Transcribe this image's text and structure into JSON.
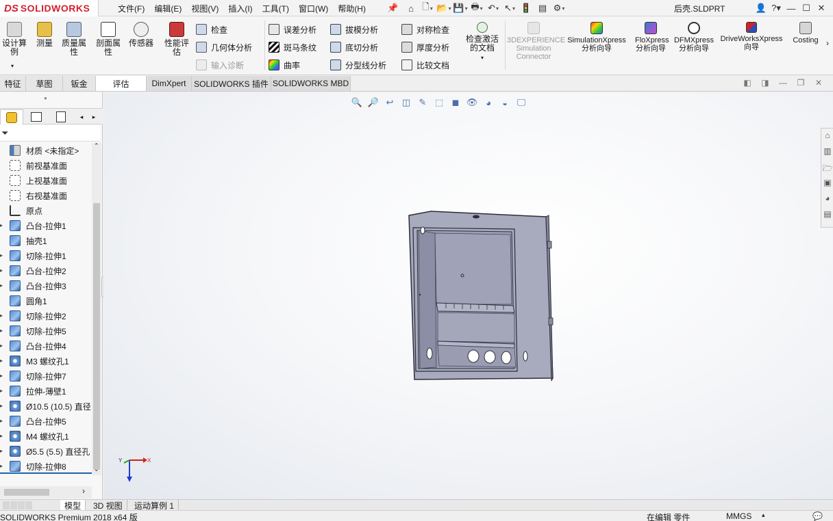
{
  "app": {
    "logo_ds": "DS",
    "logo_text": "SOLIDWORKS",
    "doc_title": "后壳.SLDPRT"
  },
  "menu": [
    "文件(F)",
    "编辑(E)",
    "视图(V)",
    "插入(I)",
    "工具(T)",
    "窗口(W)",
    "帮助(H)"
  ],
  "toolbar_big": [
    {
      "label": "设计算例",
      "icon": "design-study-icon"
    },
    {
      "label": "测量",
      "icon": "measure-icon"
    },
    {
      "label": "质量属性",
      "icon": "mass-properties-icon"
    },
    {
      "label": "剖面属性",
      "icon": "section-properties-icon"
    },
    {
      "label": "传感器",
      "icon": "sensor-icon"
    },
    {
      "label": "性能评估",
      "icon": "performance-evaluation-icon"
    }
  ],
  "toolbar_col1": [
    {
      "label": "检查",
      "disabled": false
    },
    {
      "label": "几何体分析",
      "disabled": false
    },
    {
      "label": "输入诊断",
      "disabled": true
    }
  ],
  "toolbar_col2": [
    {
      "label": "误差分析"
    },
    {
      "label": "斑马条纹"
    },
    {
      "label": "曲率"
    }
  ],
  "toolbar_col3": [
    {
      "label": "拔模分析"
    },
    {
      "label": "底切分析"
    },
    {
      "label": "分型线分析"
    }
  ],
  "toolbar_col4": [
    {
      "label": "对称检查"
    },
    {
      "label": "厚度分析"
    },
    {
      "label": "比较文档"
    }
  ],
  "toolbar_check_active": "检查激活的文档",
  "toolbar_addins": [
    {
      "label": "3DEXPERIENCE Simulation Connector",
      "disabled": true
    },
    {
      "label": "SimulationXpress 分析向导",
      "disabled": false
    },
    {
      "label": "FloXpress 分析向导",
      "disabled": false
    },
    {
      "label": "DFMXpress 分析向导",
      "disabled": false
    },
    {
      "label": "DriveWorksXpress 向导",
      "disabled": false
    },
    {
      "label": "Costing",
      "disabled": false
    }
  ],
  "tabs": [
    {
      "label": "特征",
      "active": false
    },
    {
      "label": "草图",
      "active": false
    },
    {
      "label": "钣金",
      "active": false
    },
    {
      "label": "评估",
      "active": true
    },
    {
      "label": "DimXpert",
      "active": false
    },
    {
      "label": "SOLIDWORKS 插件",
      "active": false
    },
    {
      "label": "SOLIDWORKS MBD",
      "active": false
    }
  ],
  "feature_tree": [
    {
      "label": "材质 <未指定>",
      "icon": "material-icon",
      "expand": false
    },
    {
      "label": "前视基准面",
      "icon": "plane-icon",
      "expand": false
    },
    {
      "label": "上视基准面",
      "icon": "plane-icon",
      "expand": false
    },
    {
      "label": "右视基准面",
      "icon": "plane-icon",
      "expand": false
    },
    {
      "label": "原点",
      "icon": "origin-icon",
      "expand": false
    },
    {
      "label": "凸台-拉伸1",
      "icon": "boss-extrude-icon",
      "expand": true
    },
    {
      "label": "抽壳1",
      "icon": "shell-icon",
      "expand": false
    },
    {
      "label": "切除-拉伸1",
      "icon": "cut-extrude-icon",
      "expand": true
    },
    {
      "label": "凸台-拉伸2",
      "icon": "boss-extrude-icon",
      "expand": true
    },
    {
      "label": "凸台-拉伸3",
      "icon": "boss-extrude-icon",
      "expand": true
    },
    {
      "label": "圆角1",
      "icon": "fillet-icon",
      "expand": false
    },
    {
      "label": "切除-拉伸2",
      "icon": "cut-extrude-icon",
      "expand": true
    },
    {
      "label": "切除-拉伸5",
      "icon": "cut-extrude-icon",
      "expand": true
    },
    {
      "label": "凸台-拉伸4",
      "icon": "boss-extrude-icon",
      "expand": true
    },
    {
      "label": "M3 螺纹孔1",
      "icon": "hole-icon",
      "expand": true
    },
    {
      "label": "切除-拉伸7",
      "icon": "cut-extrude-icon",
      "expand": true
    },
    {
      "label": "拉伸-薄壁1",
      "icon": "thin-extrude-icon",
      "expand": true
    },
    {
      "label": "Ø10.5 (10.5) 直径",
      "icon": "hole-icon",
      "expand": true
    },
    {
      "label": "凸台-拉伸5",
      "icon": "boss-extrude-icon",
      "expand": true
    },
    {
      "label": "M4 螺纹孔1",
      "icon": "hole-icon",
      "expand": true
    },
    {
      "label": "Ø5.5 (5.5) 直径孔",
      "icon": "hole-icon",
      "expand": true
    },
    {
      "label": "切除-拉伸8",
      "icon": "cut-extrude-icon",
      "expand": true
    }
  ],
  "bottom_tabs": [
    {
      "label": "模型",
      "active": true
    },
    {
      "label": "3D 视图",
      "active": false
    },
    {
      "label": "运动算例 1",
      "active": false
    }
  ],
  "status": {
    "product": "SOLIDWORKS Premium 2018 x64 版",
    "mode": "在编辑 零件",
    "units": "MMGS"
  },
  "triad": {
    "x": "X",
    "y": "Y"
  }
}
